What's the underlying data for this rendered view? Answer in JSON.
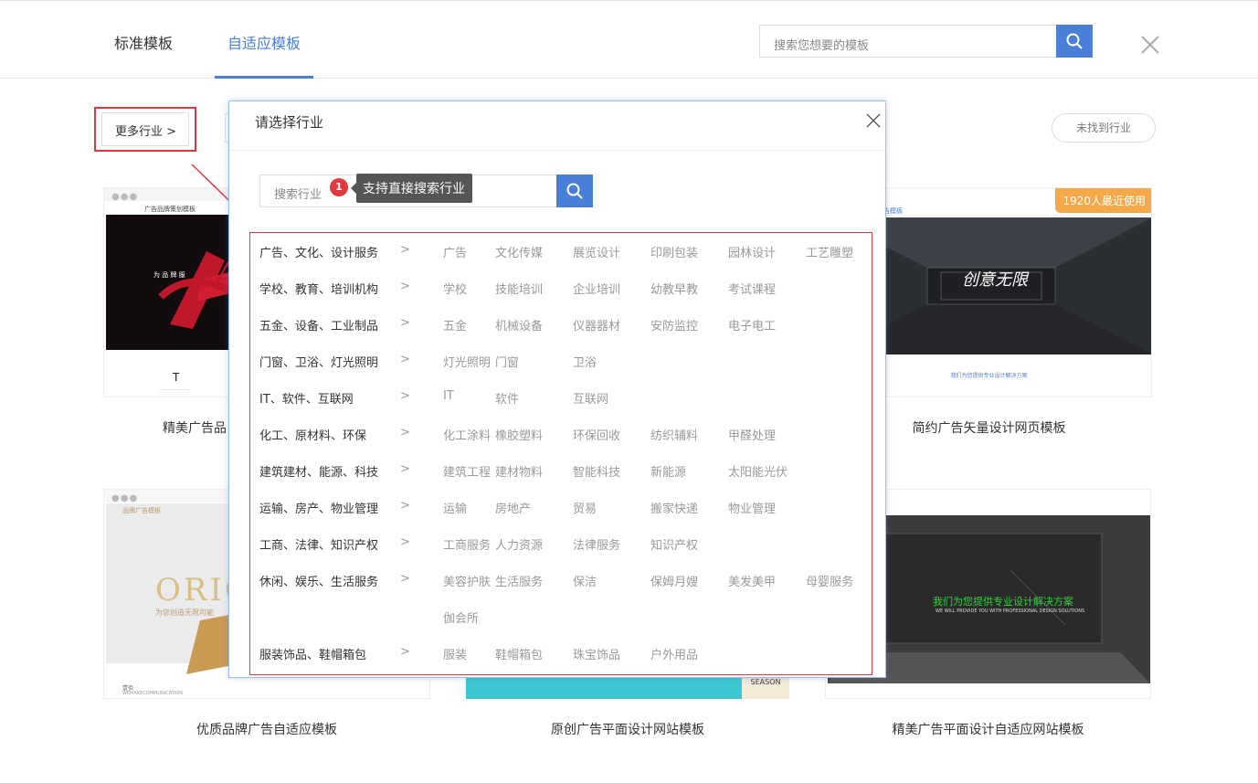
{
  "header": {
    "tab_standard": "标准模板",
    "tab_adaptive": "自适应模板",
    "search_placeholder": "搜索您想要的模板"
  },
  "filters": {
    "more_industry": "更多行业 >",
    "not_found": "未找到行业"
  },
  "cards": [
    {
      "title": "精美广告品",
      "preview_logo": "广告品牌策划模板",
      "preview_text": "T",
      "brand": ""
    },
    {
      "title": "简约广告矢量设计网页模板",
      "badge": "1920人最近使用",
      "brand": "广告模板",
      "hero_text": "创意无限",
      "footer": "我们为您提供专业设计解决方案"
    },
    {
      "title": "优质品牌广告自适应模板",
      "brand": "品牌广告模板",
      "hero_text": "ORIC",
      "hero_sub": "为您创造无限可能",
      "foot1": "壹佰",
      "foot2": "WEMAKECOMMUNICATION"
    },
    {
      "title": "原创广告平面设计网站模板",
      "season": "SEASON"
    },
    {
      "title": "精美广告平面设计自适应网站模板",
      "hero_text": "我们为您提供专业设计解决方案",
      "hero_sub": "WE WILL PROVIDE YOU WITH PROFESSIONAL DESIGN SOLUTIONS"
    }
  ],
  "modal": {
    "title": "请选择行业",
    "search_placeholder": "搜索行业",
    "tip_number": "1",
    "tip_text": "支持直接搜索行业",
    "industries": [
      {
        "category": "广告、文化、设计服务",
        "subs": [
          "广告",
          "文化传媒",
          "展览设计",
          "印刷包装",
          "园林设计",
          "工艺雕塑"
        ]
      },
      {
        "category": "学校、教育、培训机构",
        "subs": [
          "学校",
          "技能培训",
          "企业培训",
          "幼教早教",
          "考试课程"
        ]
      },
      {
        "category": "五金、设备、工业制品",
        "subs": [
          "五金",
          "机械设备",
          "仪器器材",
          "安防监控",
          "电子电工"
        ]
      },
      {
        "category": "门窗、卫浴、灯光照明",
        "subs": [
          "灯光照明",
          "门窗",
          "卫浴"
        ]
      },
      {
        "category": "IT、软件、互联网",
        "subs": [
          "IT",
          "软件",
          "互联网"
        ]
      },
      {
        "category": "化工、原材料、环保",
        "subs": [
          "化工涂料",
          "橡胶塑料",
          "环保回收",
          "纺织辅料",
          "甲醛处理"
        ]
      },
      {
        "category": "建筑建材、能源、科技",
        "subs": [
          "建筑工程",
          "建材物料",
          "智能科技",
          "新能源",
          "太阳能光伏"
        ]
      },
      {
        "category": "运输、房产、物业管理",
        "subs": [
          "运输",
          "房地产",
          "贸易",
          "搬家快递",
          "物业管理"
        ]
      },
      {
        "category": "工商、法律、知识产权",
        "subs": [
          "工商服务",
          "人力资源",
          "法律服务",
          "知识产权"
        ]
      },
      {
        "category": "休闲、娱乐、生活服务",
        "subs": [
          "美容护肤",
          "生活服务",
          "保洁",
          "保姆月嫂",
          "美发美甲",
          "母婴服务",
          "伽会所"
        ]
      },
      {
        "category": "服装饰品、鞋帽箱包",
        "subs": [
          "服装",
          "鞋帽箱包",
          "珠宝饰品",
          "户外用品"
        ]
      }
    ],
    "chevron": ">"
  },
  "colors": {
    "accent": "#4a7fd8",
    "highlight_red": "#e0393e",
    "badge_orange": "#f5a847"
  }
}
